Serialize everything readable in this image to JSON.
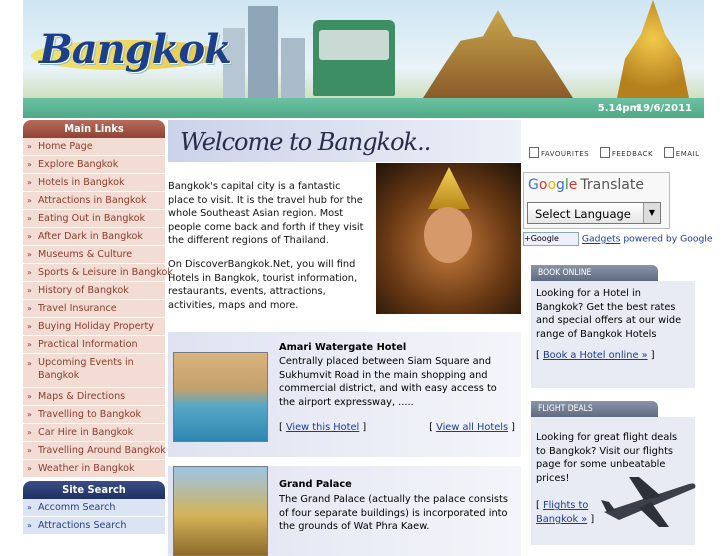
{
  "header": {
    "logo_text": "Bangkok",
    "time": "5.14pm",
    "date": "19/6/2011"
  },
  "nav_main": {
    "title": "Main Links",
    "items": [
      "Home Page",
      "Explore Bangkok",
      "Hotels in Bangkok",
      "Attractions in Bangkok",
      "Eating Out in Bangkok",
      "After Dark in Bangkok",
      "Museums & Culture",
      "Sports & Leisure in Bangkok",
      "History of Bangkok",
      "Travel Insurance",
      "Buying Holiday Property",
      "Practical Information",
      "Upcoming Events in Bangkok",
      "Maps & Directions",
      "Travelling to Bangkok",
      "Car Hire in Bangkok",
      "Travelling Around Bangkok",
      "Weather in Bangkok"
    ]
  },
  "nav_search": {
    "title": "Site Search",
    "items": [
      "Accomm Search",
      "Attractions Search"
    ]
  },
  "center": {
    "welcome": "Welcome to Bangkok..",
    "intro_1": "Bangkok's capital city is a fantastic place to visit. It is the travel hub for the whole Southeast Asian region. Most people come back and forth if they visit the different regions of Thailand.",
    "intro_2": "On DiscoverBangkok.Net, you will find Hotels in Bangkok, tourist information, restaurants, events, attractions, activities, maps and more.",
    "hotel": {
      "name": "Amari Watergate Hotel",
      "desc": "Centrally placed between Siam Square and Sukhumvit Road in the main shopping and commercial district, and with easy access to the airport expressway, .....",
      "link_view": "View this Hotel",
      "link_all": "View all Hotels"
    },
    "attraction": {
      "name": "Grand Palace",
      "desc": "The Grand Palace (actually the palace consists of four separate buildings) is incorporated into the grounds of Wat Phra Kaew."
    }
  },
  "right": {
    "tools": [
      "FAVOURITES",
      "FEEDBACK",
      "EMAIL"
    ],
    "translate_logo": "Google",
    "translate_word": "Translate",
    "select_language": "Select Language",
    "gadgets_btn": "+Google",
    "gadgets_link": "Gadgets",
    "gadgets_pb": "powered by Google",
    "book_online": {
      "title": "BOOK ONLINE",
      "text": "Looking for a Hotel in Bangkok? Get the best rates and special offers at our wide range of Bangkok Hotels",
      "link": "Book a Hotel online »"
    },
    "flight_deals": {
      "title": "FLIGHT DEALS",
      "text": "Looking for great flight deals to Bangkok? Visit our flights page for some unbeatable prices!",
      "link": "Flights to Bangkok »"
    }
  },
  "colors": {
    "nav_red": "#8e4334",
    "nav_blue": "#1f2f62",
    "date_bar": "#4ea986",
    "link": "#1a3a9a"
  }
}
